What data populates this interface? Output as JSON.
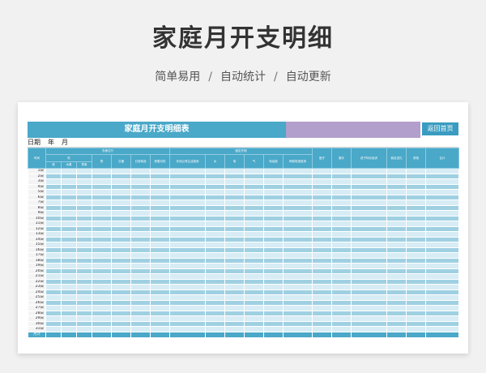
{
  "header": {
    "title": "家庭月开支明细",
    "subtitle_items": [
      "简单易用",
      "自动统计",
      "自动更新"
    ],
    "separator": "/"
  },
  "sheet": {
    "title": "家庭月开支明细表",
    "back_button": "返回首页",
    "date_label": "日期",
    "year_label": "年",
    "month_label": "月",
    "time_label": "时间",
    "groups": {
      "daily": "衣食住行",
      "fixed": "固定开销"
    },
    "sub_groups": {
      "eat": "吃"
    },
    "leaf": {
      "vegetable": "菜",
      "fruit": "水果",
      "snack": "零食"
    },
    "columns": [
      "穿",
      "交通",
      "日用商品",
      "房屋月供",
      "孙钱父母生活费用",
      "水",
      "电",
      "气",
      "电话费",
      "网络电视费用",
      "医疗",
      "娱乐",
      "孩子特长培训",
      "朋友送礼",
      "其他",
      "合计"
    ],
    "days": [
      "1日",
      "2日",
      "3日",
      "4日",
      "5日",
      "6日",
      "7日",
      "8日",
      "9日",
      "10日",
      "11日",
      "12日",
      "13日",
      "14日",
      "15日",
      "16日",
      "17日",
      "18日",
      "19日",
      "20日",
      "21日",
      "22日",
      "23日",
      "24日",
      "25日",
      "26日",
      "27日",
      "28日",
      "29日",
      "30日",
      "31日"
    ],
    "total_label": "月计"
  },
  "colors": {
    "header_blue": "#4aa8c8",
    "title_purple": "#b39fcb",
    "row_light": "#d7ecf4",
    "row_dark": "#9fd0e2"
  }
}
